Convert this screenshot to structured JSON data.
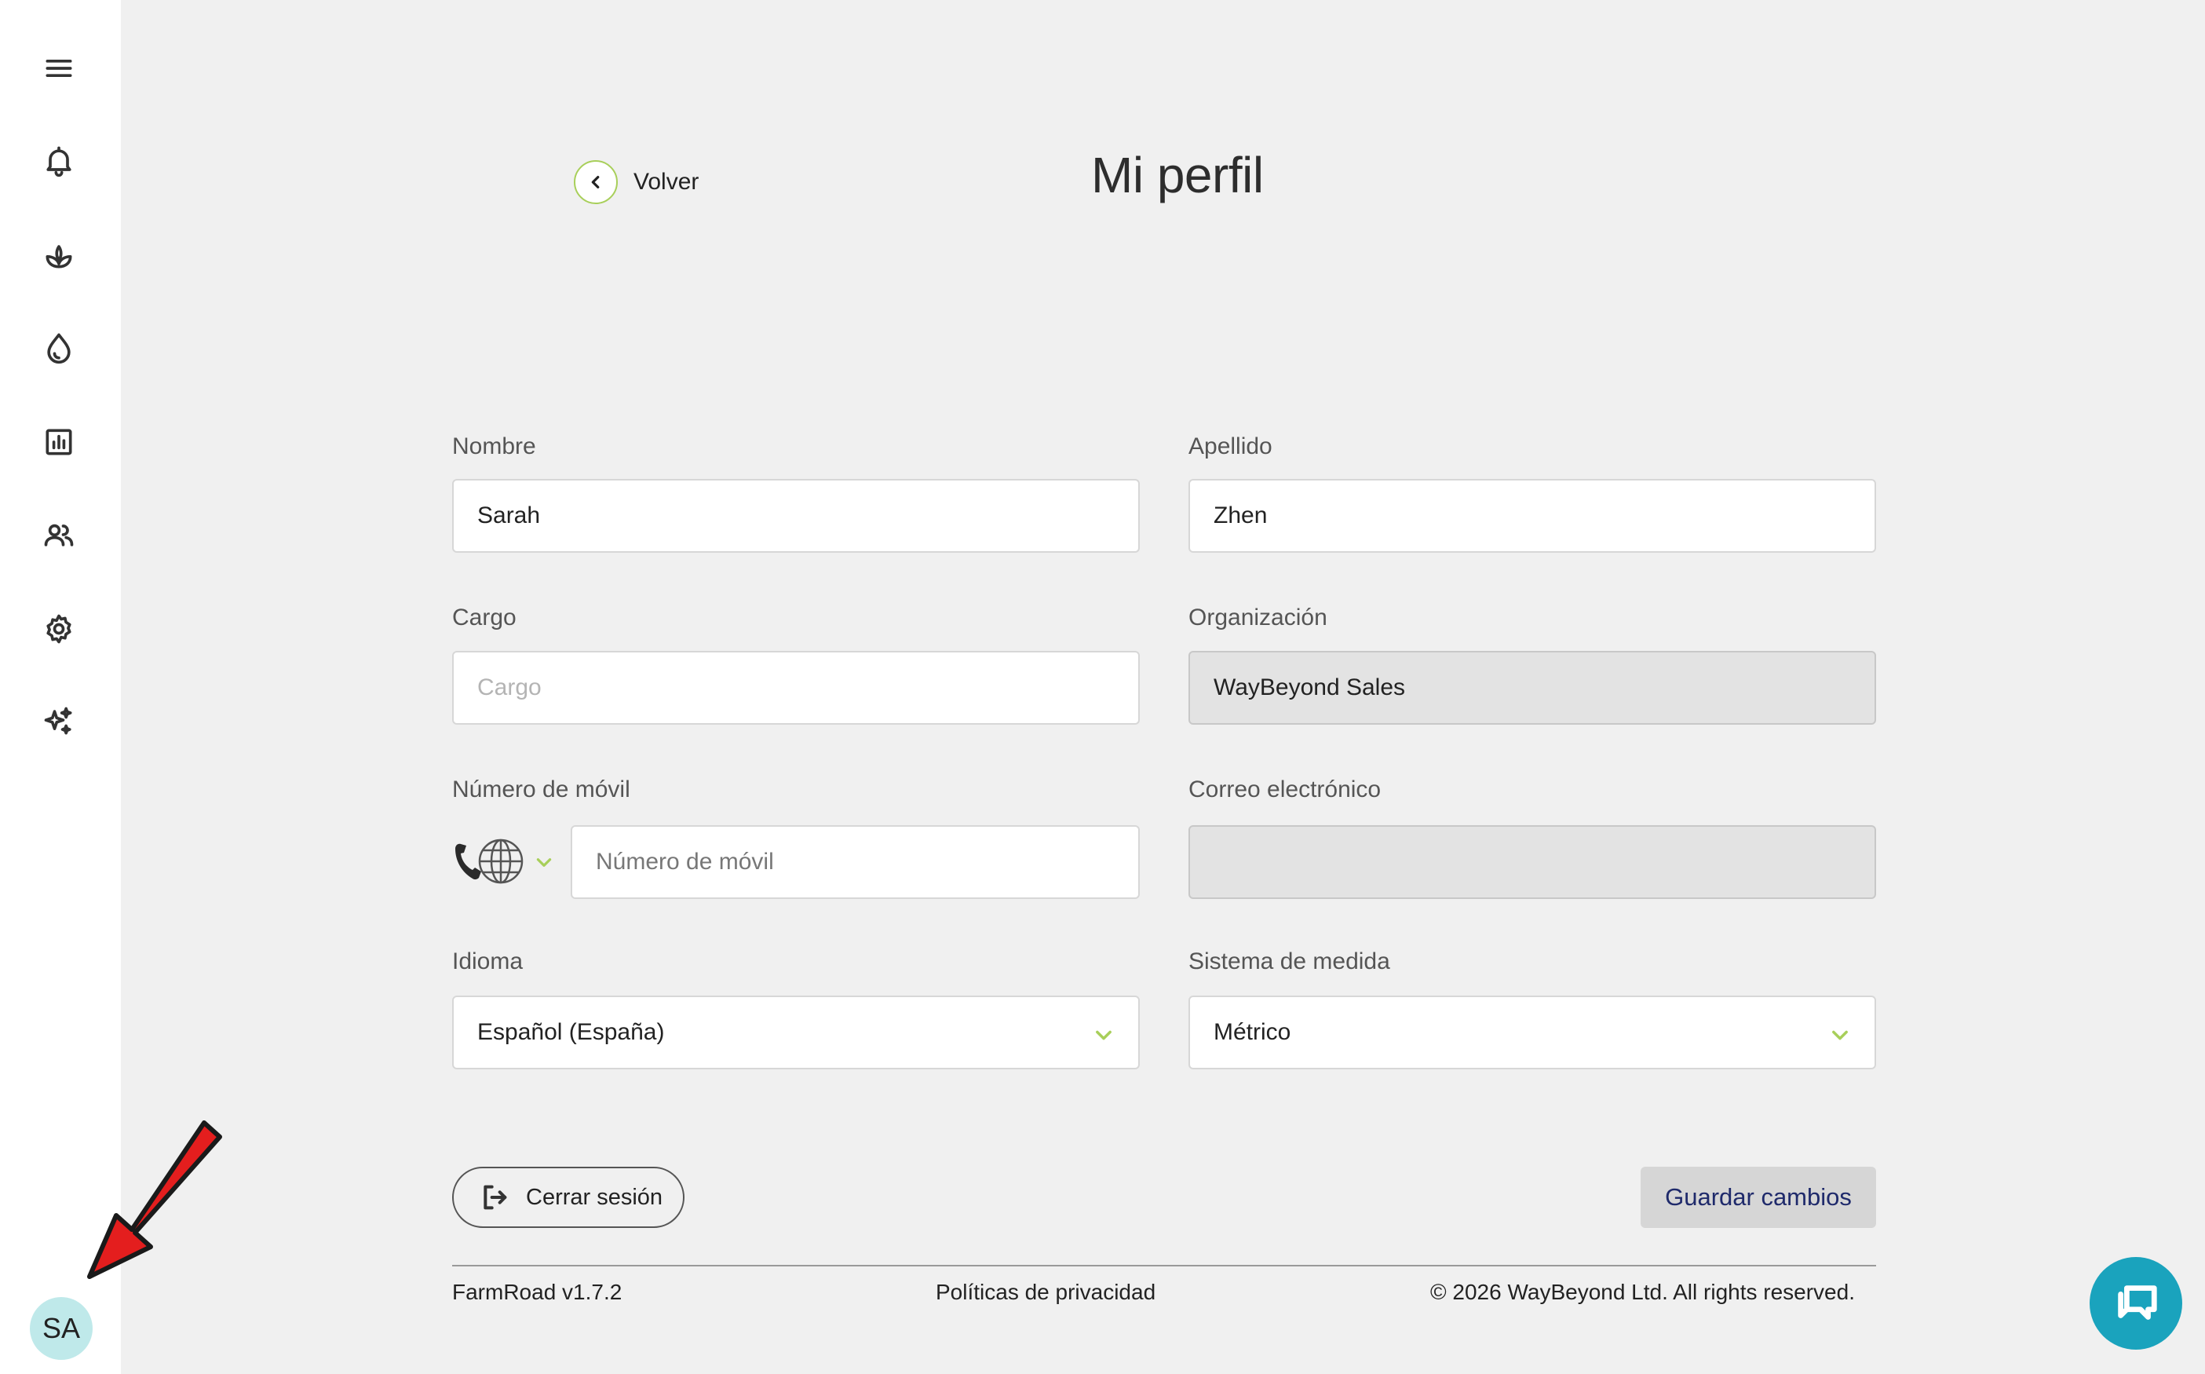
{
  "sidebar": {
    "icons": [
      "menu-icon",
      "bell-icon",
      "sprout-icon",
      "water-drop-icon",
      "chart-icon",
      "users-icon",
      "gear-icon",
      "sparkles-icon"
    ],
    "avatar_initials": "SA"
  },
  "header": {
    "back_label": "Volver",
    "title": "Mi perfil"
  },
  "form": {
    "nombre": {
      "label": "Nombre",
      "value": "Sarah"
    },
    "apellido": {
      "label": "Apellido",
      "value": "Zhen"
    },
    "cargo": {
      "label": "Cargo",
      "placeholder": "Cargo",
      "value": ""
    },
    "organizacion": {
      "label": "Organización",
      "value": "WayBeyond Sales"
    },
    "movil": {
      "label": "Número de móvil",
      "placeholder": "Número de móvil",
      "value": ""
    },
    "correo": {
      "label": "Correo electrónico",
      "value": ""
    },
    "idioma": {
      "label": "Idioma",
      "value": "Español (España)"
    },
    "sistema": {
      "label": "Sistema de medida",
      "value": "Métrico"
    }
  },
  "actions": {
    "logout_label": "Cerrar sesión",
    "save_label": "Guardar cambios"
  },
  "footer": {
    "version": "FarmRoad v1.7.2",
    "privacy": "Políticas de privacidad",
    "copyright": "© 2026 WayBeyond Ltd. All rights reserved."
  },
  "colors": {
    "accent_green": "#a8cf5a",
    "chat_button": "#1aa3bd",
    "avatar_bg": "#bfe9ea",
    "save_text": "#1f2a6b",
    "annotation_arrow": "#e41e1e"
  }
}
